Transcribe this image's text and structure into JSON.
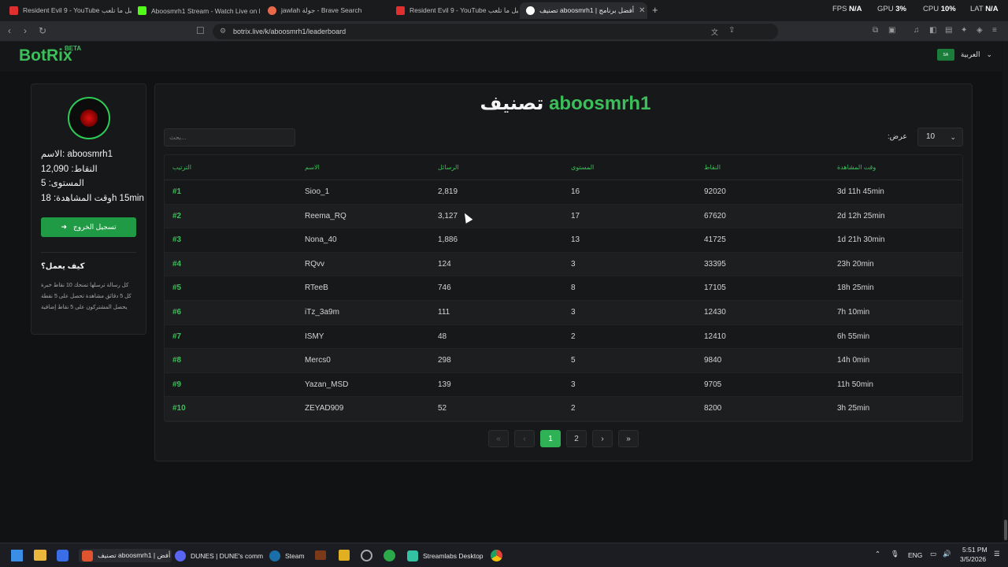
{
  "browser": {
    "tabs": [
      {
        "title": "Resident Evil 9 - YouTube قبل ما تلعب",
        "icon": "youtube-icon",
        "color": "#e02f2f"
      },
      {
        "title": "Aboosmrh1 Stream - Watch Live on K",
        "icon": "kick-icon",
        "color": "#53fc18"
      },
      {
        "title": "jawlah جولة - Brave Search",
        "icon": "brave-search-icon",
        "color": "#e86a4a"
      },
      {
        "title": "Resident Evil 9 - YouTube قبل ما تلعب",
        "icon": "youtube-icon",
        "color": "#e02f2f"
      },
      {
        "title": "تصنيف aboosmrh1 | أفضل برنامج",
        "icon": "botrix-icon",
        "color": "#ffffff"
      }
    ],
    "new_tab": "+",
    "url": "botrix.live/k/aboosmrh1/leaderboard",
    "stats": {
      "fps_label": "FPS",
      "fps_value": "N/A",
      "gpu_label": "GPU",
      "gpu_value": "3%",
      "cpu_label": "CPU",
      "cpu_value": "10%",
      "lat_label": "LAT",
      "lat_value": "N/A"
    }
  },
  "site": {
    "logo": "BotRix",
    "beta": "BETA",
    "language": "العربية",
    "flag_text": "SA",
    "accent": "#3cbf5a"
  },
  "profile": {
    "name_line": "الاسم: aboosmrh1",
    "points_line": "النقاط: 12,090",
    "level_line": "المستوى: 5",
    "watch_line": "وقت المشاهدة: 18h 15min",
    "logout": "تسجيل الخروج",
    "how_title": "كيف يعمل؟",
    "how_lines": [
      "كل رسالة ترسلها تمنحك 10 نقاط خبرة",
      "كل 5 دقائق مشاهدة تحصل على 5 نقطة",
      "يحصل المشتركون على 5 نقاط إضافية"
    ]
  },
  "leaderboard": {
    "title_user": "aboosmrh1",
    "title_word": "تصنيف",
    "search_placeholder": "بحث...",
    "show_label": ":عرض",
    "page_size": "10",
    "columns": [
      "الترتيب",
      "الاسم",
      "الرسائل",
      "المستوى",
      "النقاط",
      "وقت المشاهدة"
    ],
    "rows": [
      [
        "#1",
        "Sioo_1",
        "2,819",
        "16",
        "92020",
        "3d 11h 45min"
      ],
      [
        "#2",
        "Reema_RQ",
        "3,127",
        "17",
        "67620",
        "2d 12h 25min"
      ],
      [
        "#3",
        "Nona_40",
        "1,886",
        "13",
        "41725",
        "1d 21h 30min"
      ],
      [
        "#4",
        "RQvv",
        "124",
        "3",
        "33395",
        "23h 20min"
      ],
      [
        "#5",
        "RTeeB",
        "746",
        "8",
        "17105",
        "18h 25min"
      ],
      [
        "#6",
        "iTz_3a9m",
        "111",
        "3",
        "12430",
        "7h 10min"
      ],
      [
        "#7",
        "ISMY",
        "48",
        "2",
        "12410",
        "6h 55min"
      ],
      [
        "#8",
        "Mercs0",
        "298",
        "5",
        "9840",
        "14h 0min"
      ],
      [
        "#9",
        "Yazan_MSD",
        "139",
        "3",
        "9705",
        "11h 50min"
      ],
      [
        "#10",
        "ZEYAD909",
        "52",
        "2",
        "8200",
        "3h 25min"
      ]
    ],
    "pagination": {
      "first": "«",
      "prev": "‹",
      "pages": [
        "1",
        "2"
      ],
      "current": "1",
      "next": "›",
      "last": "»"
    }
  },
  "taskbar": {
    "apps": [
      {
        "label": "تصنيف aboosmrh1 | أفض",
        "icon": "brave-icon",
        "color": "#e0532f"
      },
      {
        "label": "DUNES | DUNE's comm",
        "icon": "discord-icon",
        "color": "#5865f2"
      },
      {
        "label": "Steam",
        "icon": "steam-icon",
        "color": "#1b6fa8"
      },
      {
        "label": "Streamlabs Desktop",
        "icon": "streamlabs-icon",
        "color": "#31c3a2"
      }
    ],
    "lang": "ENG",
    "time": "5:51 PM",
    "date": "3/5/2026"
  }
}
